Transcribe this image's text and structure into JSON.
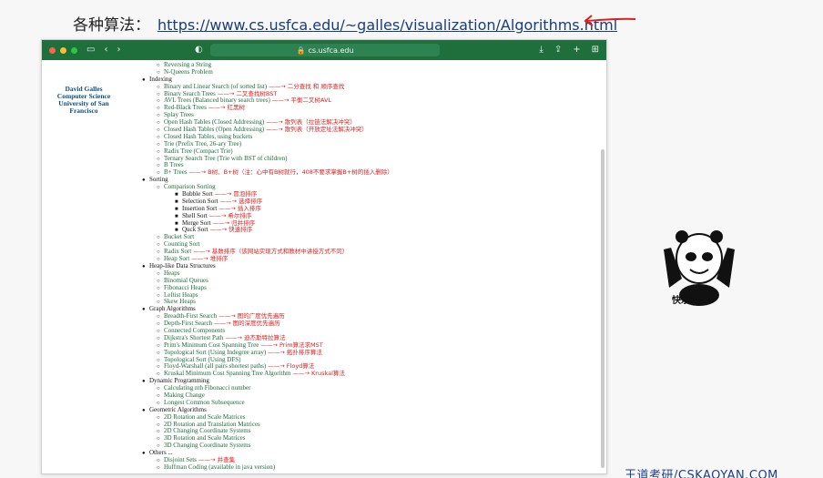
{
  "heading": {
    "label": "各种算法：",
    "link": "https://www.cs.usfca.edu/~galles/visualization/Algorithms.html"
  },
  "browser": {
    "url": "cs.usfca.edu",
    "toolbar_color": "#1f6f3c"
  },
  "sidebar": {
    "lines": [
      "David Galles",
      "Computer Science",
      "University of San",
      "Francisco"
    ]
  },
  "tree": [
    {
      "level": 2,
      "text": "Reversing a String",
      "note": ""
    },
    {
      "level": 2,
      "text": "N-Queens Problem",
      "note": ""
    },
    {
      "level": 1,
      "text": "Indexing",
      "note": ""
    },
    {
      "level": 2,
      "text": "Binary and Linear Search (of sorted list)",
      "note": "二分查找 和 顺序查找"
    },
    {
      "level": 2,
      "text": "Binary Search Trees",
      "note": "二叉查找树BST"
    },
    {
      "level": 2,
      "text": "AVL Trees (Balanced binary search trees)",
      "note": "平衡二叉树AVL"
    },
    {
      "level": 2,
      "text": "Red-Black Trees",
      "note": "红黑树"
    },
    {
      "level": 2,
      "text": "Splay Trees",
      "note": ""
    },
    {
      "level": 2,
      "text": "Open Hash Tables (Closed Addressing)",
      "note": "散列表（拉链法解决冲突）"
    },
    {
      "level": 2,
      "text": "Closed Hash Tables (Open Addressing)",
      "note": "散列表（开放定址法解决冲突）"
    },
    {
      "level": 2,
      "text": "Closed Hash Tables, using buckets",
      "note": ""
    },
    {
      "level": 2,
      "text": "Trie (Prefix Tree, 26-ary Tree)",
      "note": ""
    },
    {
      "level": 2,
      "text": "Radix Tree (Compact Trie)",
      "note": ""
    },
    {
      "level": 2,
      "text": "Ternary Search Tree (Trie with BST of children)",
      "note": ""
    },
    {
      "level": 2,
      "text": "B Trees",
      "note": ""
    },
    {
      "level": 2,
      "text": "B+ Trees",
      "note": "B树、B+树（注：心中有B树就行，408不要求掌握B+树的插入删除）"
    },
    {
      "level": 1,
      "text": "Sorting",
      "note": ""
    },
    {
      "level": 2,
      "text": "Comparison Sorting",
      "note": ""
    },
    {
      "level": 3,
      "text": "Bubble Sort",
      "note": "冒泡排序"
    },
    {
      "level": 3,
      "text": "Selection Sort",
      "note": "选择排序"
    },
    {
      "level": 3,
      "text": "Insertion Sort",
      "note": "插入排序"
    },
    {
      "level": 3,
      "text": "Shell Sort",
      "note": "希尔排序"
    },
    {
      "level": 3,
      "text": "Merge Sort",
      "note": "归并排序"
    },
    {
      "level": 3,
      "text": "Quck Sort",
      "note": "快速排序"
    },
    {
      "level": 2,
      "text": "Bucket Sort",
      "note": ""
    },
    {
      "level": 2,
      "text": "Counting Sort",
      "note": ""
    },
    {
      "level": 2,
      "text": "Radix Sort",
      "note": "基数排序（该网站实现方式和教材中讲授方式不同）"
    },
    {
      "level": 2,
      "text": "Heap Sort",
      "note": "堆排序"
    },
    {
      "level": 1,
      "text": "Heap-like Data Structures",
      "note": ""
    },
    {
      "level": 2,
      "text": "Heaps",
      "note": ""
    },
    {
      "level": 2,
      "text": "Binomial Queues",
      "note": ""
    },
    {
      "level": 2,
      "text": "Fibonacci Heaps",
      "note": ""
    },
    {
      "level": 2,
      "text": "Leftist Heaps",
      "note": ""
    },
    {
      "level": 2,
      "text": "Skew Heaps",
      "note": ""
    },
    {
      "level": 1,
      "text": "Graph Algorithms",
      "note": ""
    },
    {
      "level": 2,
      "text": "Breadth-First Search",
      "note": "图的广度优先遍历"
    },
    {
      "level": 2,
      "text": "Depth-First Search",
      "note": "图的深度优先遍历"
    },
    {
      "level": 2,
      "text": "Connected Components",
      "note": ""
    },
    {
      "level": 2,
      "text": "Dijkstra's Shortest Path",
      "note": "迪杰斯特拉算法"
    },
    {
      "level": 2,
      "text": "Prim's Minimum Cost Spanning Tree",
      "note": "Prim算法求MST"
    },
    {
      "level": 2,
      "text": "Topological Sort (Using Indegree array)",
      "note": "拓扑排序算法"
    },
    {
      "level": 2,
      "text": "Topological Sort (Using DFS)",
      "note": ""
    },
    {
      "level": 2,
      "text": "Floyd-Warshall (all pairs shortest paths)",
      "note": "Floyd算法"
    },
    {
      "level": 2,
      "text": "Kruskal Minimum Cost Spanning Tree Algorithm",
      "note": "Kruskal算法"
    },
    {
      "level": 1,
      "text": "Dynamic Programming",
      "note": ""
    },
    {
      "level": 2,
      "text": "Calculating nth Fibonacci number",
      "note": ""
    },
    {
      "level": 2,
      "text": "Making Change",
      "note": ""
    },
    {
      "level": 2,
      "text": "Longest Common Subsequence",
      "note": ""
    },
    {
      "level": 1,
      "text": "Geometric Algorithms",
      "note": ""
    },
    {
      "level": 2,
      "text": "2D Rotation and Scale Matrices",
      "note": ""
    },
    {
      "level": 2,
      "text": "2D Rotation and Translation Matrices",
      "note": ""
    },
    {
      "level": 2,
      "text": "2D Changing Coordinate Systems",
      "note": ""
    },
    {
      "level": 2,
      "text": "3D Rotation and Scale Matrices",
      "note": ""
    },
    {
      "level": 2,
      "text": "3D Changing Coordinate Systems",
      "note": ""
    },
    {
      "level": 1,
      "text": "Others ...",
      "note": ""
    },
    {
      "level": 2,
      "text": "Disjoint Sets",
      "note": "并查集"
    },
    {
      "level": 2,
      "text": "Huffman Coding (available in java version)",
      "note": ""
    }
  ],
  "meme": {
    "caption": "快乐！！！"
  },
  "watermark": "王道考研/CSKAOYAN.COM",
  "colors": {
    "accent_red": "#d82020",
    "link_blue": "#1a3d7c"
  }
}
